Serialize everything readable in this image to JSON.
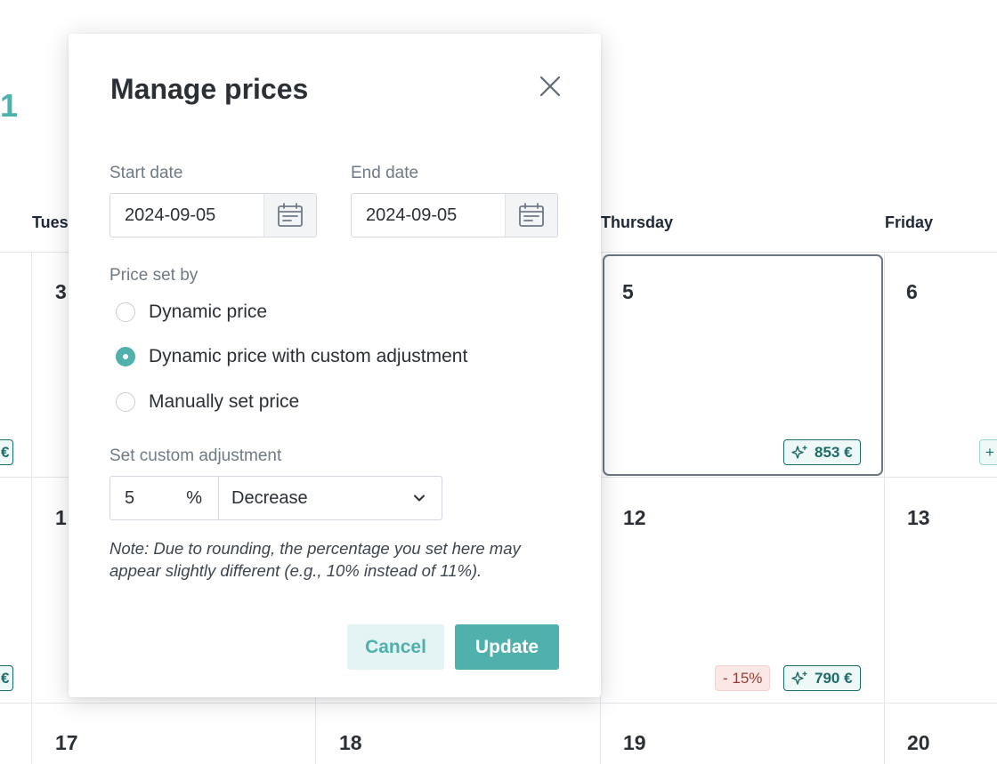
{
  "background": {
    "title_fragment": "1",
    "weekdays": {
      "tuesday": "Tues",
      "thursday": "Thursday",
      "friday": "Friday"
    },
    "days": {
      "d3": "3",
      "d5": "5",
      "d6": "6",
      "d1x": "1",
      "d12": "12",
      "d13": "13",
      "d17": "17",
      "d18": "18",
      "d19": "19",
      "d20": "20"
    },
    "badges": {
      "thu5_price": "853 €",
      "thu12_price": "790 €",
      "thu12_pct": "- 15%",
      "left_edge_1": "€",
      "left_edge_2": "€",
      "right_edge": "+"
    },
    "colors": {
      "accent": "#4fb0ac",
      "badge_text": "#1b6b68",
      "pct_bg": "#fbe8e6"
    }
  },
  "modal": {
    "title": "Manage prices",
    "close_icon": "close-icon",
    "start_date": {
      "label": "Start date",
      "value": "2024-09-05"
    },
    "end_date": {
      "label": "End date",
      "value": "2024-09-05"
    },
    "price_set_by": {
      "label": "Price set by",
      "options": [
        {
          "label": "Dynamic price",
          "selected": false
        },
        {
          "label": "Dynamic price with custom adjustment",
          "selected": true
        },
        {
          "label": "Manually set price",
          "selected": false
        }
      ]
    },
    "custom_adjustment": {
      "label": "Set custom adjustment",
      "value": "5",
      "unit": "%",
      "direction": "Decrease"
    },
    "note": "Note: Due to rounding, the percentage you set here may appear slightly different (e.g., 10% instead of 11%).",
    "buttons": {
      "cancel": "Cancel",
      "update": "Update"
    }
  }
}
